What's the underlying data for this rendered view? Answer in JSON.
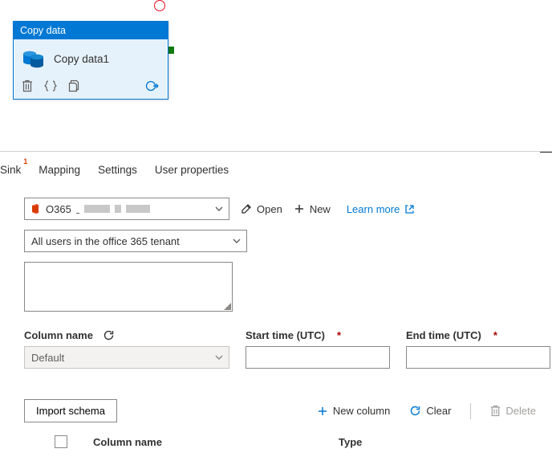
{
  "activity": {
    "header": "Copy data",
    "title": "Copy data1"
  },
  "tabs": {
    "sink": "Sink",
    "sink_badge": "1",
    "mapping": "Mapping",
    "settings": "Settings",
    "user_properties": "User properties"
  },
  "source": {
    "dataset_prefix": "O365",
    "open": "Open",
    "new": "New",
    "learn_more": "Learn more"
  },
  "scope": {
    "value": "All users in the office 365 tenant"
  },
  "labels": {
    "column_name": "Column name",
    "start_time": "Start time (UTC)",
    "end_time": "End time (UTC)"
  },
  "column_select": {
    "value": "Default"
  },
  "schema": {
    "import": "Import schema",
    "new_column": "New column",
    "clear": "Clear",
    "delete": "Delete"
  },
  "table_header": {
    "column_name": "Column name",
    "type": "Type"
  }
}
